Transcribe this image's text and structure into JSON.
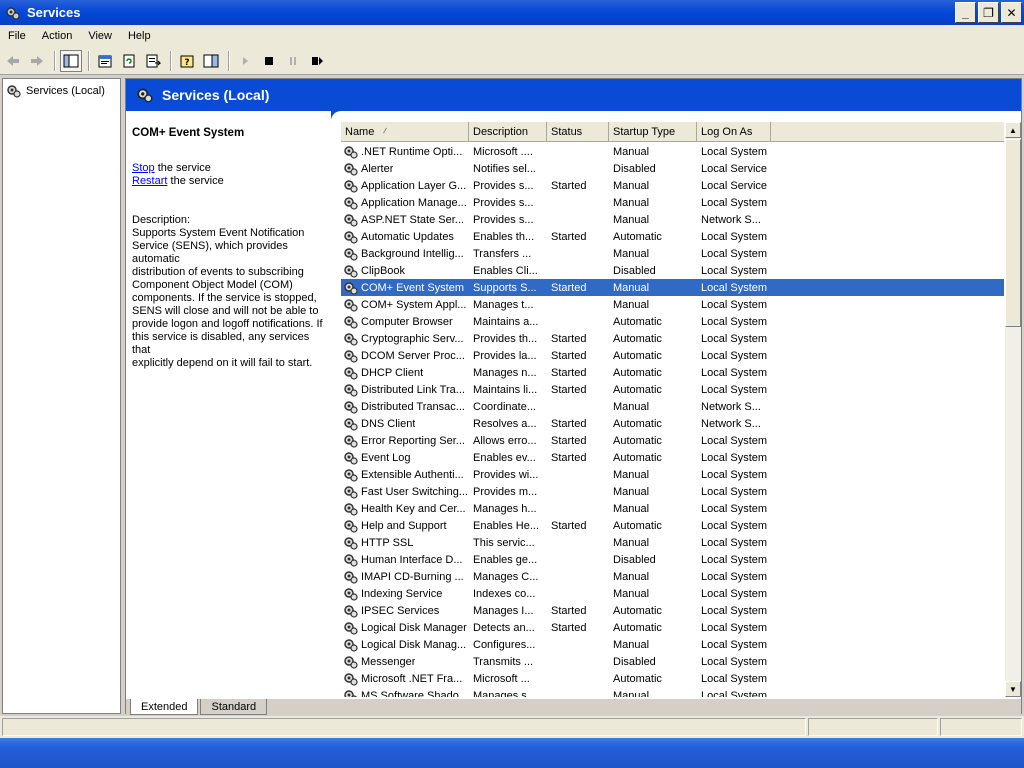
{
  "window": {
    "title": "Services"
  },
  "menu": [
    "File",
    "Action",
    "View",
    "Help"
  ],
  "tree": {
    "root_label": "Services (Local)"
  },
  "header": {
    "title": "Services (Local)"
  },
  "details": {
    "service_name": "COM+ Event System",
    "stop_link": "Stop",
    "stop_suffix": " the service",
    "restart_link": "Restart",
    "restart_suffix": " the service",
    "description_label": "Description:",
    "description_lines": [
      "Supports System Event Notification",
      "Service (SENS), which provides automatic",
      "distribution of events to subscribing",
      "Component Object Model (COM)",
      "components. If the service is stopped,",
      "SENS will close and will not be able to",
      "provide logon and logoff notifications. If",
      "this service is disabled, any services that",
      "explicitly depend on it will fail to start."
    ]
  },
  "list": {
    "columns": [
      "Name",
      "Description",
      "Status",
      "Startup Type",
      "Log On As"
    ],
    "selected_index": 8,
    "rows": [
      [
        ".NET Runtime Opti...",
        "Microsoft ....",
        "",
        "Manual",
        "Local System"
      ],
      [
        "Alerter",
        "Notifies sel...",
        "",
        "Disabled",
        "Local Service"
      ],
      [
        "Application Layer G...",
        "Provides s...",
        "Started",
        "Manual",
        "Local Service"
      ],
      [
        "Application Manage...",
        "Provides s...",
        "",
        "Manual",
        "Local System"
      ],
      [
        "ASP.NET State Ser...",
        "Provides s...",
        "",
        "Manual",
        "Network S..."
      ],
      [
        "Automatic Updates",
        "Enables th...",
        "Started",
        "Automatic",
        "Local System"
      ],
      [
        "Background Intellig...",
        "Transfers ...",
        "",
        "Manual",
        "Local System"
      ],
      [
        "ClipBook",
        "Enables Cli...",
        "",
        "Disabled",
        "Local System"
      ],
      [
        "COM+ Event System",
        "Supports S...",
        "Started",
        "Manual",
        "Local System"
      ],
      [
        "COM+ System Appl...",
        "Manages t...",
        "",
        "Manual",
        "Local System"
      ],
      [
        "Computer Browser",
        "Maintains a...",
        "",
        "Automatic",
        "Local System"
      ],
      [
        "Cryptographic Serv...",
        "Provides th...",
        "Started",
        "Automatic",
        "Local System"
      ],
      [
        "DCOM Server Proc...",
        "Provides la...",
        "Started",
        "Automatic",
        "Local System"
      ],
      [
        "DHCP Client",
        "Manages n...",
        "Started",
        "Automatic",
        "Local System"
      ],
      [
        "Distributed Link Tra...",
        "Maintains li...",
        "Started",
        "Automatic",
        "Local System"
      ],
      [
        "Distributed Transac...",
        "Coordinate...",
        "",
        "Manual",
        "Network S..."
      ],
      [
        "DNS Client",
        "Resolves a...",
        "Started",
        "Automatic",
        "Network S..."
      ],
      [
        "Error Reporting Ser...",
        "Allows erro...",
        "Started",
        "Automatic",
        "Local System"
      ],
      [
        "Event Log",
        "Enables ev...",
        "Started",
        "Automatic",
        "Local System"
      ],
      [
        "Extensible Authenti...",
        "Provides wi...",
        "",
        "Manual",
        "Local System"
      ],
      [
        "Fast User Switching...",
        "Provides m...",
        "",
        "Manual",
        "Local System"
      ],
      [
        "Health Key and Cer...",
        "Manages h...",
        "",
        "Manual",
        "Local System"
      ],
      [
        "Help and Support",
        "Enables He...",
        "Started",
        "Automatic",
        "Local System"
      ],
      [
        "HTTP SSL",
        "This servic...",
        "",
        "Manual",
        "Local System"
      ],
      [
        "Human Interface D...",
        "Enables ge...",
        "",
        "Disabled",
        "Local System"
      ],
      [
        "IMAPI CD-Burning ...",
        "Manages C...",
        "",
        "Manual",
        "Local System"
      ],
      [
        "Indexing Service",
        "Indexes co...",
        "",
        "Manual",
        "Local System"
      ],
      [
        "IPSEC Services",
        "Manages I...",
        "Started",
        "Automatic",
        "Local System"
      ],
      [
        "Logical Disk Manager",
        "Detects an...",
        "Started",
        "Automatic",
        "Local System"
      ],
      [
        "Logical Disk Manag...",
        "Configures...",
        "",
        "Manual",
        "Local System"
      ],
      [
        "Messenger",
        "Transmits ...",
        "",
        "Disabled",
        "Local System"
      ],
      [
        "Microsoft .NET Fra...",
        "Microsoft ...",
        "",
        "Automatic",
        "Local System"
      ],
      [
        "MS Software Shado...",
        "Manages s...",
        "",
        "Manual",
        "Local System"
      ]
    ]
  },
  "tabs": [
    "Extended",
    "Standard"
  ],
  "active_tab": 0,
  "icons": {
    "app": "gear-icon",
    "back": "back-arrow-icon",
    "forward": "forward-arrow-icon",
    "service": "service-gear-icon"
  }
}
